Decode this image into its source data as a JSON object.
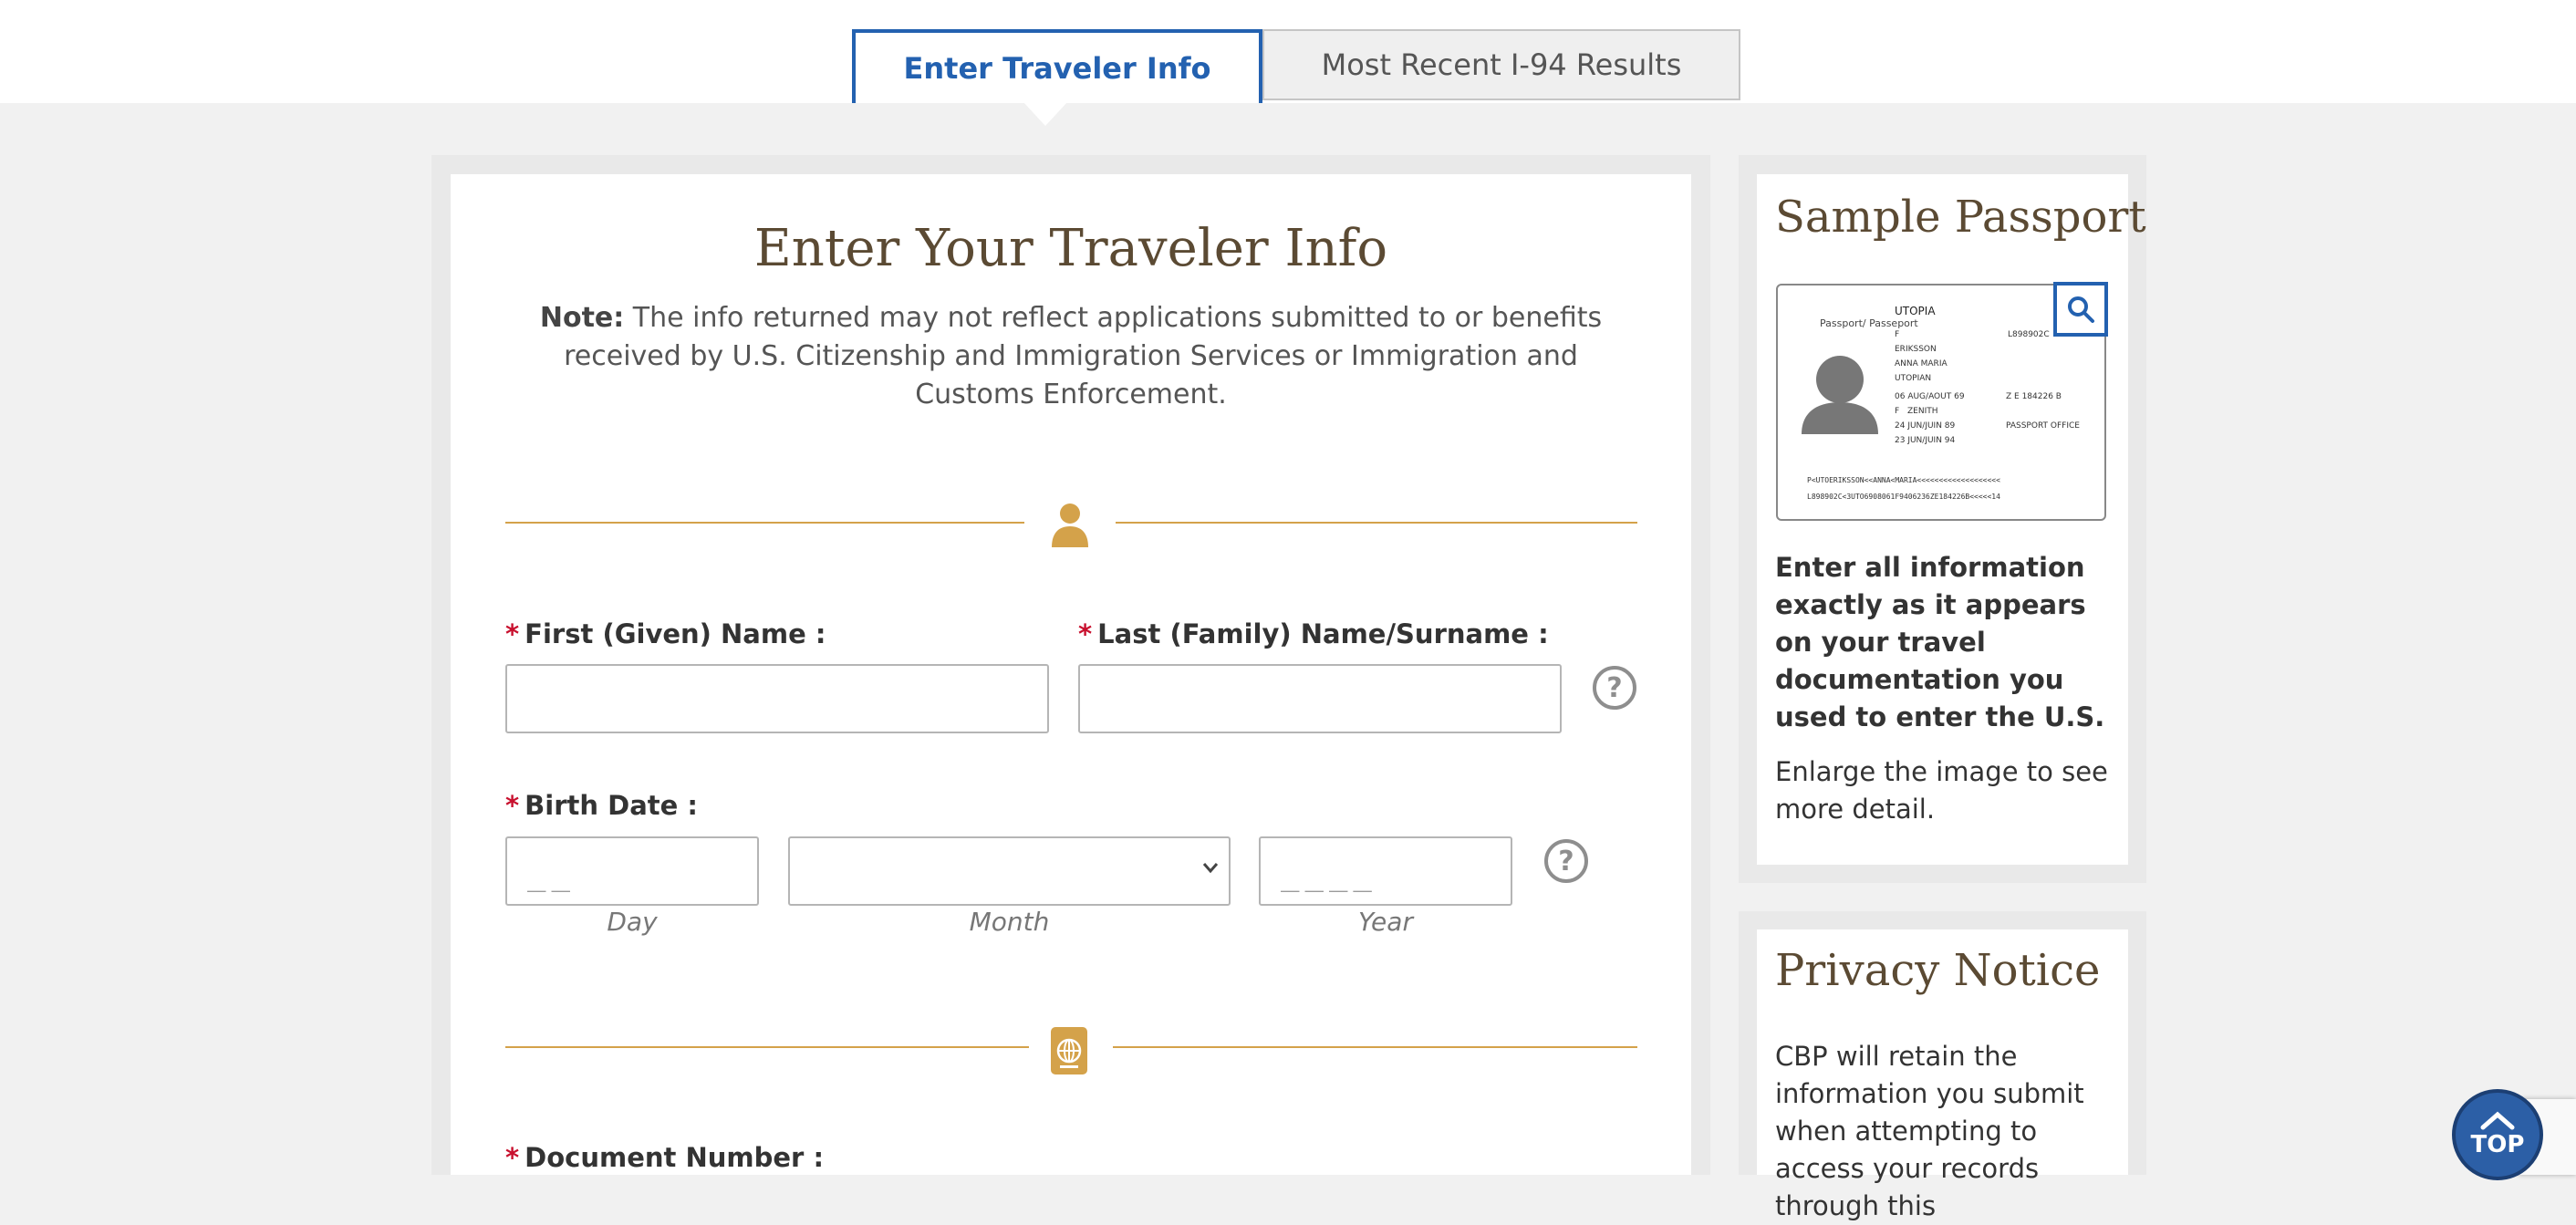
{
  "tabs": {
    "active": "Enter Traveler Info",
    "inactive": "Most Recent I-94 Results"
  },
  "main": {
    "title": "Enter Your Traveler Info",
    "note_label": "Note:",
    "note_text": " The info returned may not reflect applications submitted to or benefits received by U.S. Citizenship and Immigration Services or Immigration and Customs Enforcement.",
    "required_marker": "*",
    "first_name_label": "First (Given) Name :",
    "last_name_label": "Last (Family) Name/Surname :",
    "birth_date_label": "Birth Date :",
    "day_placeholder": "__",
    "year_placeholder": "____",
    "day_caption": "Day",
    "month_caption": "Month",
    "year_caption": "Year",
    "document_number_label": "Document Number :",
    "help_glyph": "?"
  },
  "sidebar": {
    "sample_title": "Sample Passport",
    "sample_bold": "Enter all information exactly as it appears on your travel documentation you used to enter the U.S.",
    "sample_text": "Enlarge the image to see more detail.",
    "passport": {
      "header": "Passport/ Passeport",
      "country": "UTOPIA",
      "surname": "ERIKSSON",
      "given": "ANNA MARIA",
      "nationality": "UTOPIAN",
      "dob": "06 AUG/AOUT 69",
      "sex": "F",
      "birthplace": "ZENITH",
      "issue": "24 JUN/JUIN 89",
      "expiry": "23 JUN/JUIN 94",
      "number": "L898902C",
      "authority": "PASSPORT OFFICE",
      "personal_no": "Z E 184226 B",
      "mrz1": "P<UTOERIKSSON<<ANNA<MARIA<<<<<<<<<<<<<<<<<<<",
      "mrz2": "L898902C<3UTO6908061F9406236ZE184226B<<<<<14"
    },
    "privacy_title": "Privacy Notice",
    "privacy_text": "CBP will retain the information you submit when attempting to access your records through this"
  },
  "top_button": "TOP",
  "colors": {
    "accent": "#2361b0",
    "gold": "#d4a24a",
    "required": "#c8102e",
    "heading": "#5b4a33"
  }
}
